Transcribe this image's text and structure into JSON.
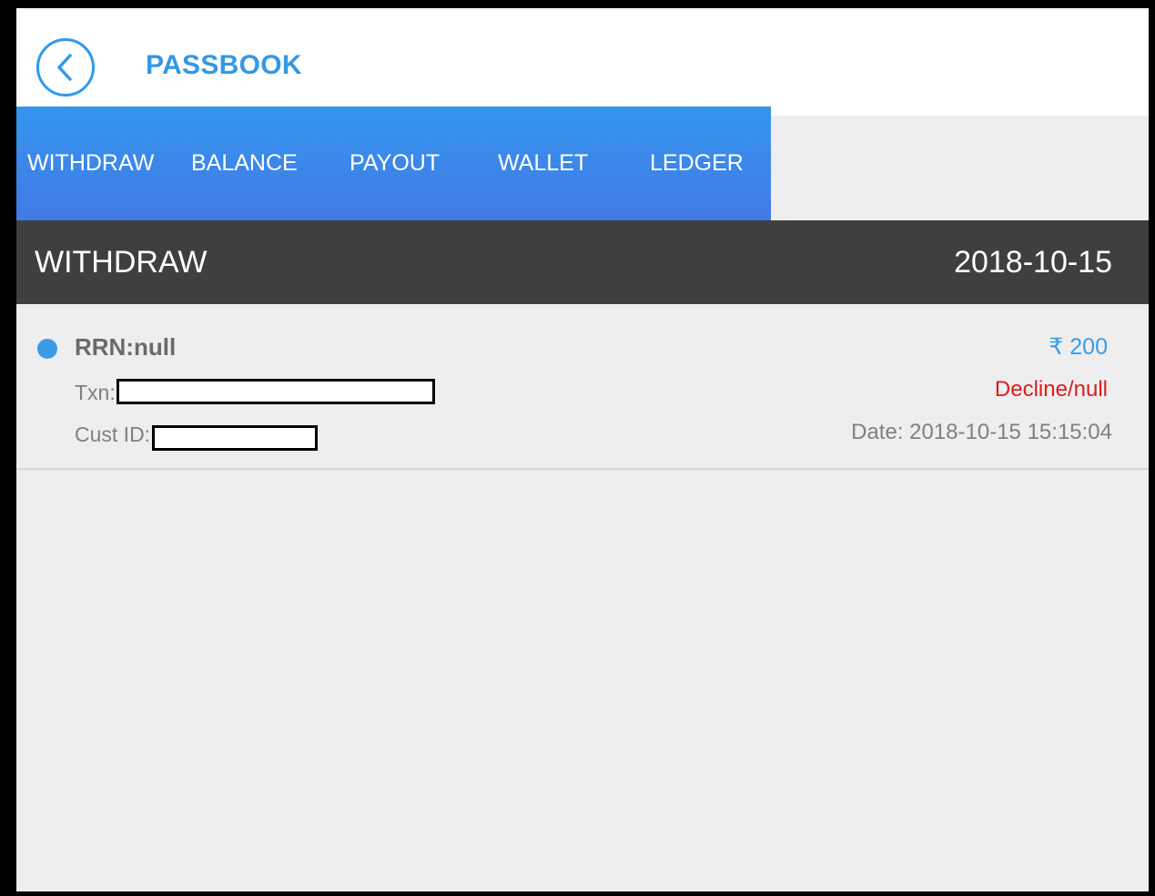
{
  "header": {
    "title": "PASSBOOK",
    "back_icon": "chevron-left-icon",
    "accent_color": "#3399e6"
  },
  "tabs": [
    {
      "label": "WITHDRAW"
    },
    {
      "label": "BALANCE"
    },
    {
      "label": "PAYOUT"
    },
    {
      "label": "WALLET"
    },
    {
      "label": "LEDGER"
    }
  ],
  "section": {
    "title": "WITHDRAW",
    "date": "2018-10-15"
  },
  "entries": [
    {
      "rrn": "RRN:null",
      "txn_label": "Txn:",
      "cust_label": "Cust ID:",
      "amount": "₹ 200",
      "status": "Decline/null",
      "date": "Date: 2018-10-15 15:15:04",
      "status_color": "#e01b1b"
    }
  ]
}
